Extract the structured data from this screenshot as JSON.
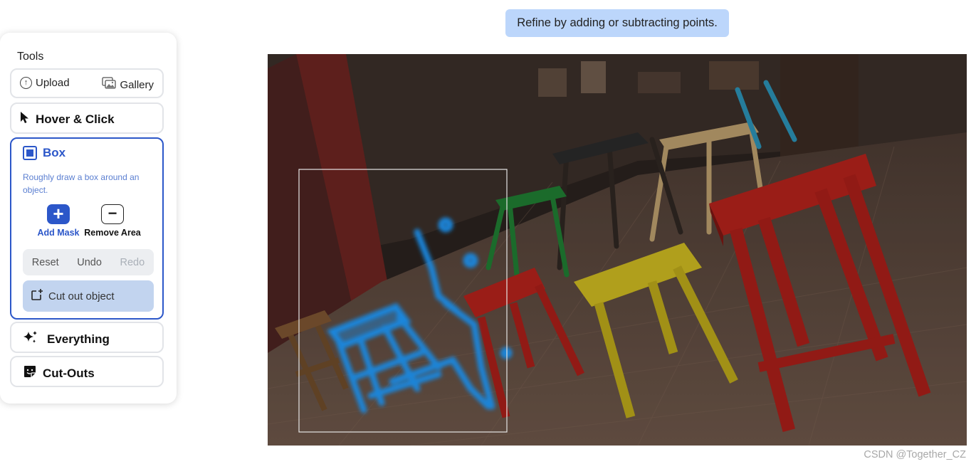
{
  "tools": {
    "title": "Tools",
    "upload_label": "Upload",
    "gallery_label": "Gallery",
    "hover_click_label": "Hover & Click",
    "box": {
      "label": "Box",
      "description": "Roughly draw a box around an object.",
      "add_mask_label": "Add Mask",
      "remove_area_label": "Remove Area",
      "reset_label": "Reset",
      "undo_label": "Undo",
      "redo_label": "Redo",
      "cut_out_label": "Cut out object"
    },
    "everything_label": "Everything",
    "cutouts_label": "Cut-Outs"
  },
  "tooltip": {
    "text": "Refine by adding or subtracting points."
  },
  "watermark": "CSDN @Together_CZ",
  "colors": {
    "accent": "#2c57c9",
    "tooltip_bg": "#bcd6fb",
    "cutout_bg": "#c2d4ef",
    "mask_glow": "#1f9bff",
    "stool_red": "#b0211b",
    "stool_yellow": "#c9b520",
    "stool_green": "#1f7a32"
  }
}
